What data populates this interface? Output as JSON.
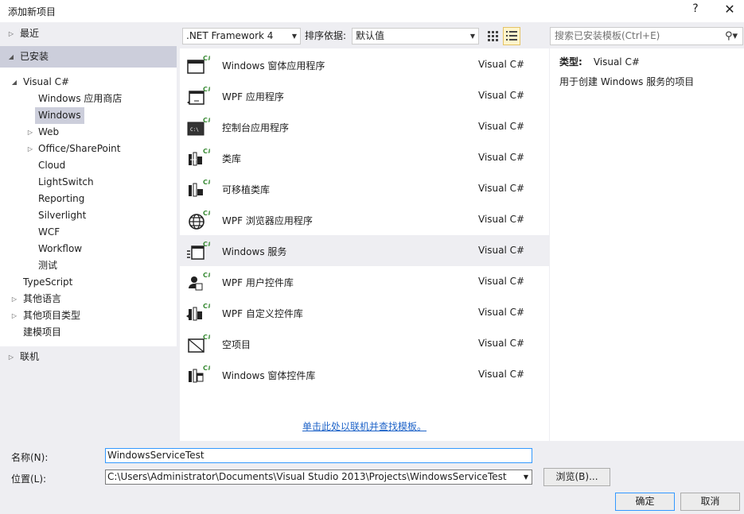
{
  "window": {
    "title": "添加新项目",
    "help": "?",
    "close": "✕"
  },
  "left_nav": {
    "recent": "最近",
    "installed": "已安装",
    "visual_csharp": "Visual C#",
    "children": [
      "Windows 应用商店",
      "Windows",
      "Web",
      "Office/SharePoint",
      "Cloud",
      "LightSwitch",
      "Reporting",
      "Silverlight",
      "WCF",
      "Workflow",
      "测试"
    ],
    "typescript": "TypeScript",
    "other_languages": "其他语言",
    "other_project_types": "其他项目类型",
    "modeling_projects": "建模项目",
    "online": "联机"
  },
  "toolbar": {
    "framework": ".NET Framework 4",
    "sort_label": "排序依据:",
    "sort_value": "默认值",
    "search_placeholder": "搜索已安装模板(Ctrl+E)"
  },
  "templates": [
    {
      "name": "Windows 窗体应用程序",
      "lang": "Visual C#",
      "icon": "winforms-icon"
    },
    {
      "name": "WPF 应用程序",
      "lang": "Visual C#",
      "icon": "wpf-app-icon"
    },
    {
      "name": "控制台应用程序",
      "lang": "Visual C#",
      "icon": "console-icon"
    },
    {
      "name": "类库",
      "lang": "Visual C#",
      "icon": "class-library-icon"
    },
    {
      "name": "可移植类库",
      "lang": "Visual C#",
      "icon": "portable-library-icon"
    },
    {
      "name": "WPF 浏览器应用程序",
      "lang": "Visual C#",
      "icon": "wpf-browser-icon"
    },
    {
      "name": "Windows 服务",
      "lang": "Visual C#",
      "icon": "windows-service-icon"
    },
    {
      "name": "WPF 用户控件库",
      "lang": "Visual C#",
      "icon": "wpf-user-control-icon"
    },
    {
      "name": "WPF 自定义控件库",
      "lang": "Visual C#",
      "icon": "wpf-custom-control-icon"
    },
    {
      "name": "空项目",
      "lang": "Visual C#",
      "icon": "empty-project-icon"
    },
    {
      "name": "Windows 窗体控件库",
      "lang": "Visual C#",
      "icon": "winforms-control-icon"
    }
  ],
  "online_link": "单击此处以联机并查找模板。",
  "details": {
    "type_label": "类型:",
    "type_value": "Visual C#",
    "description": "用于创建 Windows 服务的项目"
  },
  "form": {
    "name_label": "名称(N):",
    "name_value": "WindowsServiceTest",
    "location_label": "位置(L):",
    "location_value": "C:\\Users\\Administrator\\Documents\\Visual Studio 2013\\Projects\\WindowsServiceTest",
    "browse": "浏览(B)...",
    "ok": "确定",
    "cancel": "取消"
  },
  "colors": {
    "selection": "#cccedb",
    "link": "#1e63c8",
    "focus": "#3399ff",
    "csharp_badge": "#388a34"
  }
}
